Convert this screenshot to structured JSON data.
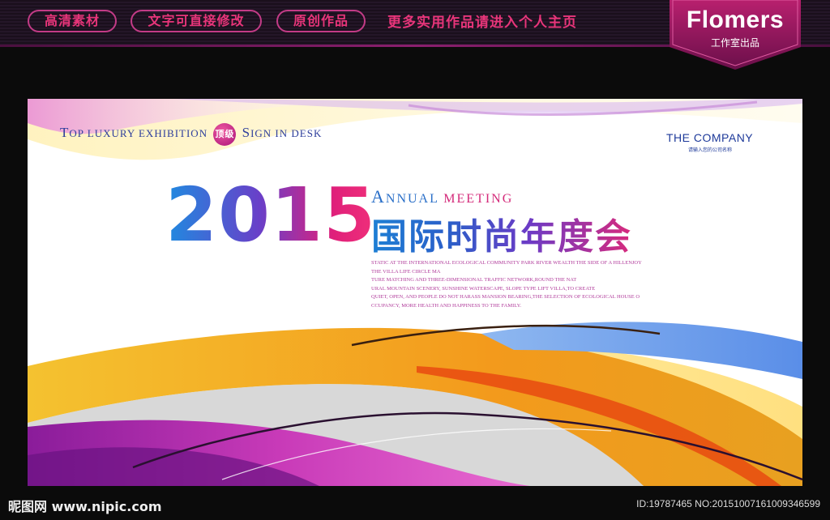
{
  "topbar": {
    "buttons": [
      "高清素材",
      "文字可直接修改",
      "原创作品"
    ],
    "note": "更多实用作品请进入个人主页",
    "brand": "Flomers",
    "brand_sub": "工作室出品"
  },
  "banner": {
    "top_line": {
      "part1_cap": "T",
      "part1": "OP LUXURY EXHIBITION",
      "badge": "顶级",
      "part2_cap": "S",
      "part2": "IGN IN DESK"
    },
    "company": "THE COMPANY",
    "company_sub": "请输入您的公司名称",
    "year": "2015",
    "annual_cap": "A",
    "annual": "NNUAL",
    "meeting": "MEETING",
    "title_cn": "国际时尚年度会",
    "description": [
      "STATIC AT THE INTERNATIONAL ECOLOGICAL COMMUNITY PARK RIVER WEALTH THE SIDE OF A HILLENJOY",
      "THE VILLA LIFE CIRCLE MA",
      "TURE MATCHING AND THREE-DIMENSIONAL TRAFFIC NETWORK,ROUND THE NAT",
      "URAL MOUNTAIN SCENERY, SUNSHINE WATERSCAPE, SLOPE TYPE LIFT VILLA,TO CREATE",
      "QUIET, OPEN, AND PEOPLE DO NOT HARASS MANSION BEARING,THE SELECTION OF ECOLOGICAL HOUSE O",
      "CCUPANCY, MORE HEALTH AND HAPPINESS TO THE FAMILY."
    ]
  },
  "footer": {
    "logo": "昵图网 www.nipic.com",
    "id": "ID:19787465 NO:20151007161009346599"
  }
}
